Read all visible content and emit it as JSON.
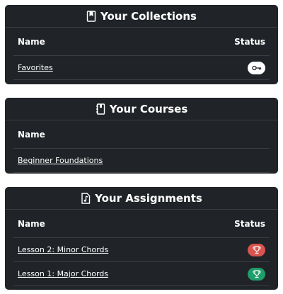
{
  "collections": {
    "title": "Your Collections",
    "icon": "bookmark-icon",
    "columns": {
      "name": "Name",
      "status": "Status"
    },
    "rows": [
      {
        "name": "Favorites",
        "status_icon": "key-icon",
        "status_color": "#ffffff"
      }
    ]
  },
  "courses": {
    "title": "Your Courses",
    "icon": "notebook-icon",
    "columns": {
      "name": "Name"
    },
    "rows": [
      {
        "name": "Beginner Foundations"
      }
    ]
  },
  "assignments": {
    "title": "Your Assignments",
    "icon": "music-file-icon",
    "columns": {
      "name": "Name",
      "status": "Status"
    },
    "rows": [
      {
        "name": "Lesson 2: Minor Chords",
        "status_icon": "trophy-icon",
        "status_color": "#d9534f"
      },
      {
        "name": "Lesson 1: Major Chords",
        "status_icon": "trophy-icon",
        "status_color": "#1e9e6a"
      }
    ]
  },
  "colors": {
    "panel_bg": "#202327",
    "divider": "#3a3d42",
    "text": "#ffffff"
  }
}
